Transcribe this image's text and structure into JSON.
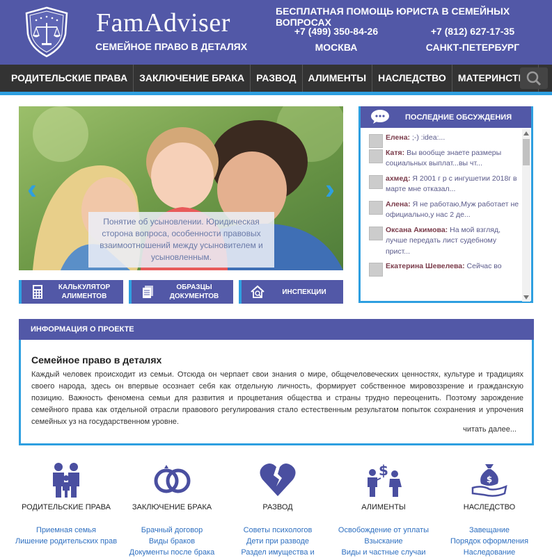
{
  "header": {
    "brand": "FamAdviser",
    "tagline": "СЕМЕЙНОЕ ПРАВО В ДЕТАЛЯХ",
    "help_text": "БЕСПЛАТНАЯ ПОМОЩЬ ЮРИСТА В СЕМЕЙНЫХ ВОПРОСАХ",
    "phones": [
      {
        "number": "+7 (499) 350-84-26",
        "city": "МОСКВА"
      },
      {
        "number": "+7 (812) 627-17-35",
        "city": "САНКТ-ПЕТЕРБУРГ"
      }
    ]
  },
  "nav": {
    "items": [
      "РОДИТЕЛЬСКИЕ ПРАВА",
      "ЗАКЛЮЧЕНИЕ БРАКА",
      "РАЗВОД",
      "АЛИМЕНТЫ",
      "НАСЛЕДСТВО",
      "МАТЕРИНСТВО"
    ],
    "search_icon": "search-icon"
  },
  "slider": {
    "caption": "Понятие об усыновлении. Юридическая сторона вопроса, особенности правовых взаимоотношений между усыновителем и усыновленным.",
    "prev": "‹",
    "next": "›"
  },
  "quick_buttons": [
    {
      "label": "КАЛЬКУЛЯТОР АЛИМЕНТОВ",
      "icon": "calculator-icon"
    },
    {
      "label": "ОБРАЗЦЫ ДОКУМЕНТОВ",
      "icon": "documents-icon"
    },
    {
      "label": "ИНСПЕКЦИИ",
      "icon": "house-search-icon"
    }
  ],
  "discussions": {
    "title": "ПОСЛЕДНИЕ ОБСУЖДЕНИЯ",
    "comments": [
      {
        "author": "Елена:",
        "text": ";-) :idea:..."
      },
      {
        "author": "Катя:",
        "text": "Вы вообще знаете размеры социальных выплат...вы чт..."
      },
      {
        "author": "ахмед:",
        "text": "Я 2001 г р с ингушетии 2018г в марте мне отказал..."
      },
      {
        "author": "Алена:",
        "text": "Я не работаю,Муж работает не официально,у нас 2 де..."
      },
      {
        "author": "Оксана Акимова:",
        "text": "На мой взгляд, лучше передать лист судебному прист..."
      },
      {
        "author": "Екатерина Шевелева:",
        "text": "Сейчас во"
      }
    ]
  },
  "info": {
    "heading": "ИНФОРМАЦИЯ О ПРОЕКТЕ",
    "title": "Семейное право в деталях",
    "text": "Каждый человек происходит из семьи. Отсюда он черпает свои знания о мире, общечеловеческих ценностях, культуре и традициях своего народа, здесь он впервые осознает себя как отдельную личность, формирует собственное мировоззрение и гражданскую позицию. Важность феномена семьи для развития и процветания общества и страны трудно переоценить. Поэтому зарождение семейного права как отдельной отрасли правового регулирования стало естественным результатом попыток сохранения и упрочения семейных уз на государственном уровне.",
    "more": "читать далее..."
  },
  "categories": [
    {
      "title": "РОДИТЕЛЬСКИЕ ПРАВА",
      "icon": "family-icon",
      "links": [
        "Приемная семья",
        "Лишение родительских прав"
      ]
    },
    {
      "title": "ЗАКЛЮЧЕНИЕ БРАКА",
      "icon": "rings-icon",
      "links": [
        "Брачный договор",
        "Виды браков",
        "Документы после брака"
      ]
    },
    {
      "title": "РАЗВОД",
      "icon": "broken-heart-icon",
      "links": [
        "Советы психологов",
        "Дети при разводе",
        "Раздел имущества и"
      ]
    },
    {
      "title": "АЛИМЕНТЫ",
      "icon": "money-people-icon",
      "links": [
        "Освобождение от уплаты",
        "Взыскание",
        "Виды и частные случаи"
      ]
    },
    {
      "title": "НАСЛЕДСТВО",
      "icon": "money-bag-hand-icon",
      "links": [
        "Завещание",
        "Порядок оформления",
        "Наследование"
      ]
    }
  ],
  "colors": {
    "primary": "#5258a7",
    "accent": "#2e9fe0",
    "nav": "#333333"
  }
}
